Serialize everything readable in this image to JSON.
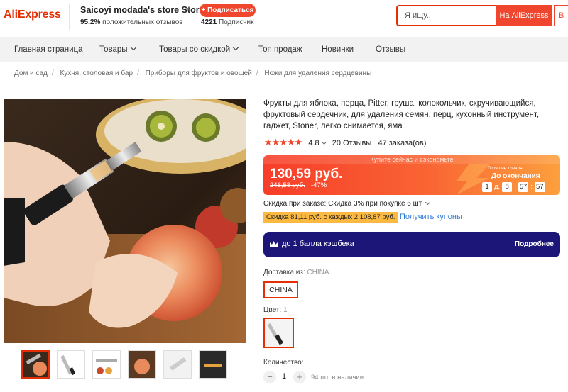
{
  "header": {
    "logo": "AliExpress",
    "store_name": "Saicoyi modada's store Store",
    "store_rating_value": "95.2%",
    "store_rating_text": "положительных отзывов",
    "subscribe_label": "+ Подписаться",
    "subscribers_count": "4221",
    "subscribers_text": "Подписчик",
    "search_placeholder": "Я ищу..",
    "search_button": "На AliExpress",
    "search_button_alt": "В"
  },
  "nav": {
    "items": [
      {
        "label": "Главная страница",
        "dropdown": false
      },
      {
        "label": "Товары",
        "dropdown": true
      },
      {
        "label": "Товары со скидкой",
        "dropdown": true
      },
      {
        "label": "Топ продаж",
        "dropdown": false
      },
      {
        "label": "Новинки",
        "dropdown": false
      },
      {
        "label": "Отзывы",
        "dropdown": false
      }
    ]
  },
  "breadcrumb": [
    "Дом и сад",
    "Кухня, столовая и бар",
    "Приборы для фруктов и овощей",
    "Ножи для удаления сердцевины"
  ],
  "product": {
    "title": "Фрукты для яблока, перца, Pitter, груша, колокольчик, скручивающийся, фруктовый сердечник, для удаления семян, перц, кухонный инструмент, гаджет, Stoner, легко снимается, яма",
    "rating": "4.8",
    "stars": 5,
    "reviews": "20 Отзывы",
    "orders": "47 заказа(ов)"
  },
  "promo": {
    "banner": "Купите сейчас и сэкономьте",
    "price": "130,59 руб.",
    "old_price": "246,58 руб.",
    "discount": "-47%",
    "hot_label": "Горящие товары",
    "until_label": "До окончания",
    "countdown": {
      "days": "1",
      "days_label": "д.",
      "hours": "8",
      "minutes": "57",
      "seconds": "57"
    }
  },
  "discount_line": "Скидка при заказе: Скидка 3% при покупке 6 шт.",
  "coupon": {
    "tag": "Скидка 81,11 руб. с каждых 2 108,87 руб.",
    "link": "Получить купоны"
  },
  "cashback": {
    "text": "до 1 балла кэшбека",
    "more": "Подробнее"
  },
  "shipping": {
    "label": "Доставка из:",
    "value": "CHINA",
    "option": "CHINA"
  },
  "color": {
    "label": "Цвет:",
    "value": "1"
  },
  "quantity": {
    "label": "Количество:",
    "value": "1",
    "minus": "−",
    "plus": "+",
    "stock": "94 шт. в наличии"
  },
  "colors": {
    "brand": "#e62e04",
    "accent": "#f0462d",
    "link": "#2e7bd6",
    "cashback_bg": "#1c1678",
    "coupon_bg": "#fcb941"
  }
}
